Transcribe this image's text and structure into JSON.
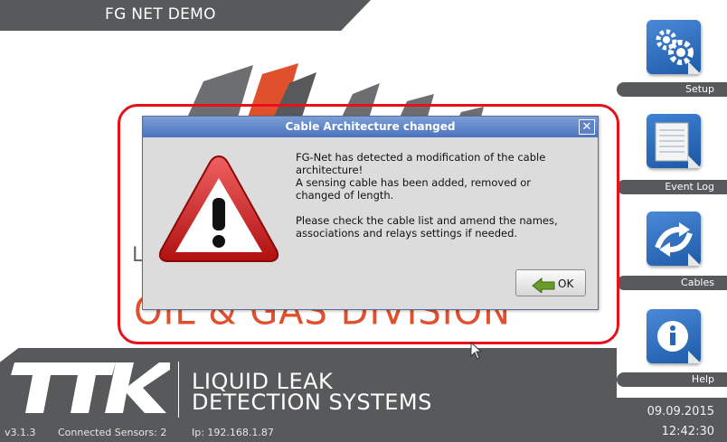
{
  "app": {
    "title": "FG NET DEMO"
  },
  "background": {
    "partial_letter": "L",
    "division_text": "OIL & GAS DIVISION"
  },
  "brand": {
    "logo": "TTK",
    "line1": "LIQUID LEAK",
    "line2": "DETECTION SYSTEMS"
  },
  "status": {
    "version": "v3.1.3",
    "sensors": "Connected Sensors: 2",
    "ip": "Ip: 192.168.1.87"
  },
  "menu": {
    "items": [
      {
        "label": "Setup",
        "icon": "gears-icon"
      },
      {
        "label": "Event Log",
        "icon": "document-icon"
      },
      {
        "label": "Cables",
        "icon": "cable-arrows-icon"
      },
      {
        "label": "Help",
        "icon": "info-icon"
      }
    ]
  },
  "clock": {
    "date": "09.09.2015",
    "time": "12:42:30"
  },
  "dialog": {
    "title": "Cable Architecture changed",
    "close": "✕",
    "lines": [
      "FG-Net has detected a modification of the cable",
      "architecture!",
      "A sensing cable has been added, removed or",
      "changed of length.",
      "",
      "Please check the cable list and amend the names,",
      "associations and relays settings if needed."
    ],
    "ok_label": "OK"
  },
  "colors": {
    "accent_red": "#e8101a",
    "brand_gray": "#58595b",
    "brand_orange": "#e0502c",
    "icon_blue": "#2f6fc0"
  }
}
